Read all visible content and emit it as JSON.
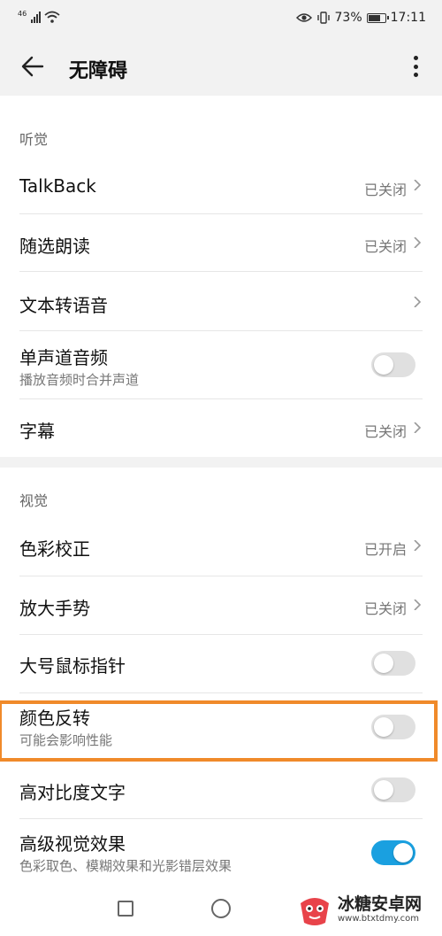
{
  "status": {
    "network": "46",
    "battery_percent": "73%",
    "time": "17:11"
  },
  "app_bar": {
    "title": "无障碍"
  },
  "hearing": {
    "section_title": "听觉",
    "talkback": {
      "label": "TalkBack",
      "value": "已关闭"
    },
    "select_to_speak": {
      "label": "随选朗读",
      "value": "已关闭"
    },
    "tts": {
      "label": "文本转语音"
    },
    "mono_audio": {
      "label": "单声道音频",
      "sub": "播放音频时合并声道",
      "enabled": false
    },
    "captions": {
      "label": "字幕",
      "value": "已关闭"
    }
  },
  "vision": {
    "section_title": "视觉",
    "color_correction": {
      "label": "色彩校正",
      "value": "已开启"
    },
    "magnification": {
      "label": "放大手势",
      "value": "已关闭"
    },
    "large_pointer": {
      "label": "大号鼠标指针",
      "enabled": false
    },
    "color_inversion": {
      "label": "颜色反转",
      "sub": "可能会影响性能",
      "enabled": false
    },
    "high_contrast": {
      "label": "高对比度文字",
      "enabled": false
    },
    "advanced_visual": {
      "label": "高级视觉效果",
      "sub": "色彩取色、模糊效果和光影错层效果",
      "enabled": true
    }
  },
  "watermark": {
    "text": "冰糖安卓网",
    "url": "www.btxtdmy.com"
  },
  "colors": {
    "accent": "#1aa0e0",
    "highlight": "#f08a2a"
  }
}
